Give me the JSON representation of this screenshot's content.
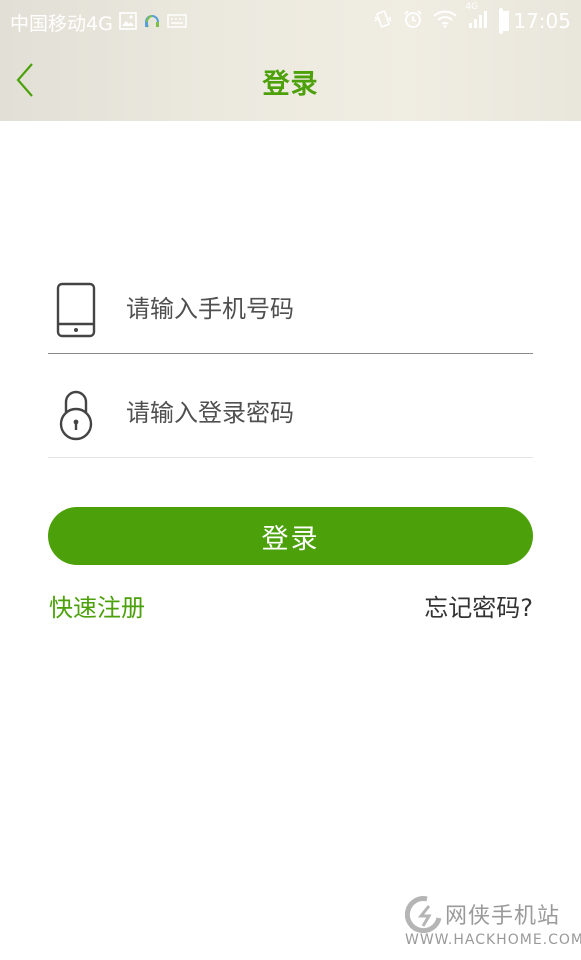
{
  "status_bar": {
    "carrier": "中国移动4G",
    "network": "4G",
    "time": "17:05"
  },
  "header": {
    "title": "登录",
    "accent_color": "#4ca10b"
  },
  "form": {
    "phone_placeholder": "请输入手机号码",
    "password_placeholder": "请输入登录密码",
    "login_label": "登录",
    "register_label": "快速注册",
    "forgot_label": "忘记密码?"
  },
  "watermark": {
    "name": "网侠手机站",
    "url": "WWW.HACKHOME.COM"
  }
}
